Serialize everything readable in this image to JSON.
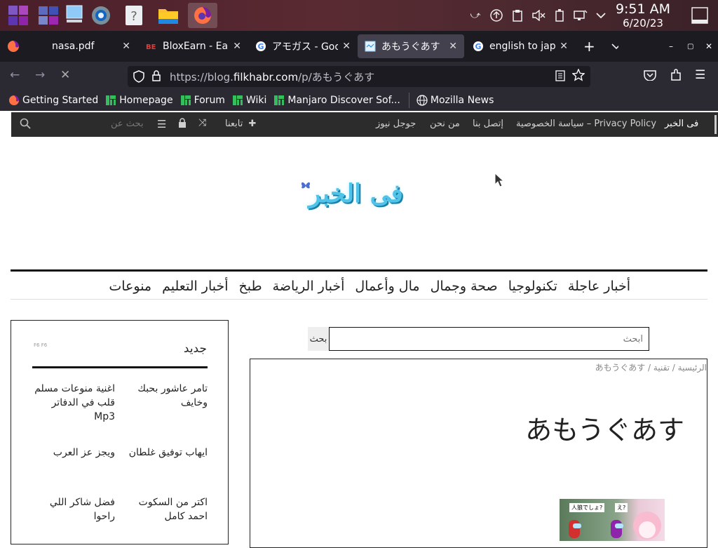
{
  "system": {
    "clock_time": "9:51 AM",
    "clock_date": "6/20/23"
  },
  "browser": {
    "tabs": [
      {
        "label": "nasa.pdf",
        "icon": "firefox-pdf-icon"
      },
      {
        "label": "BloxEarn - Earn",
        "icon": "bloxearn-icon"
      },
      {
        "label": "アモガス - Goog",
        "icon": "google-icon"
      },
      {
        "label": "あもうぐあす",
        "icon": "page-icon",
        "active": true
      },
      {
        "label": "english to japan",
        "icon": "google-icon"
      }
    ],
    "url_prefix": "https://blog.",
    "url_domain": "filkhabr.com",
    "url_path": "/p/あもうぐあす",
    "bookmarks": [
      {
        "label": "Getting Started",
        "icon": "firefox-icon"
      },
      {
        "label": "Homepage",
        "icon": "manjaro-icon"
      },
      {
        "label": "Forum",
        "icon": "manjaro-icon"
      },
      {
        "label": "Wiki",
        "icon": "manjaro-icon"
      },
      {
        "label": "Manjaro Discover Sof...",
        "icon": "manjaro-icon"
      },
      {
        "label": "Mozilla News",
        "icon": "globe-icon"
      }
    ]
  },
  "site": {
    "top_links": [
      "فى الخبر",
      "سياسة الخصوصية – Privacy Policy",
      "إتصل بنا",
      "من نحن",
      "جوجل نيوز"
    ],
    "follow_label": "تابعنا",
    "search_placeholder": "بحث عن",
    "logo_text": "فى الخبر",
    "categories": [
      "أخبار عاجلة",
      "تكنولوجيا",
      "صحة وجمال",
      "مال وأعمال",
      "أخبار الرياضة",
      "طبخ",
      "أخبار التعليم",
      "منوعات"
    ],
    "sidebar_title": "جديد",
    "sidebar_small_text": "F6 F6",
    "sidebar_items": [
      {
        "text": "تامر عاشور بحبك وخايف"
      },
      {
        "text": "اغنية منوعات مسلم قلب في الدفاتر Mp3"
      },
      {
        "text": "ايهاب توفيق غلطان"
      },
      {
        "text": "ويجز عز العرب"
      },
      {
        "text": "اكتر من السكوت احمد كامل"
      },
      {
        "text": "فضل شاكر اللي راحوا"
      }
    ],
    "search_button": "بحث",
    "search_input_placeholder": "ابحث",
    "breadcrumb": "الرئيسية / تقنية / あもうぐあす",
    "article_title": "あもうぐあす",
    "thumb_caption_left": "人狼でしょ?",
    "thumb_caption_right": "え?"
  }
}
